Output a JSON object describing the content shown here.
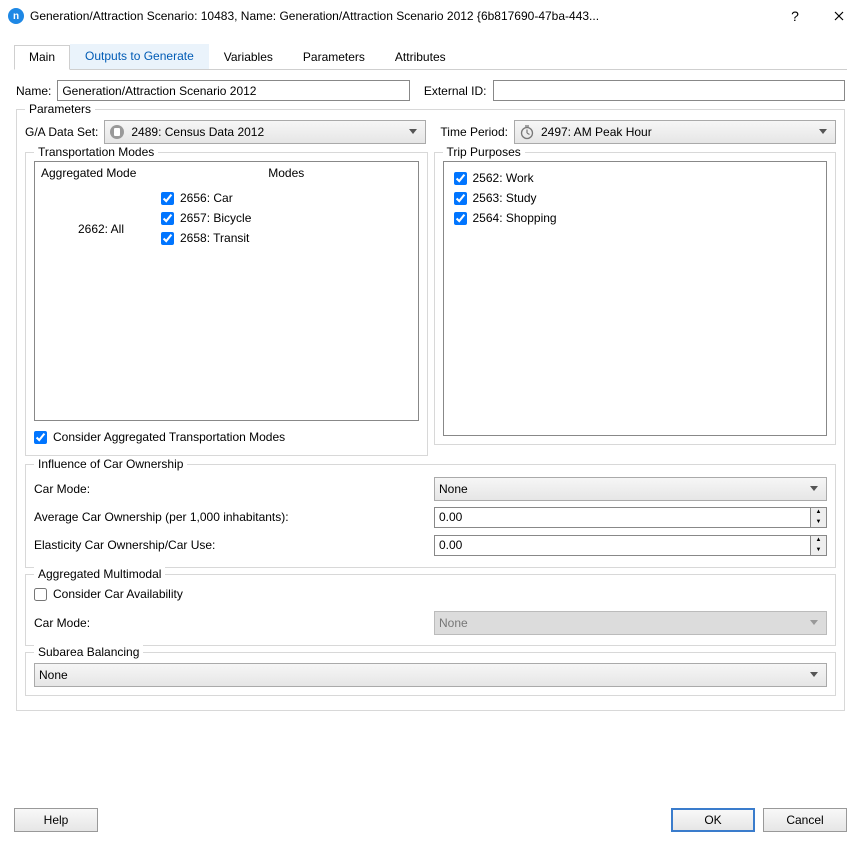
{
  "window": {
    "title": "Generation/Attraction Scenario: 10483, Name: Generation/Attraction Scenario 2012  {6b817690-47ba-443..."
  },
  "tabs": [
    "Main",
    "Outputs to Generate",
    "Variables",
    "Parameters",
    "Attributes"
  ],
  "active_tab": "Main",
  "form": {
    "name_label": "Name:",
    "name_value": "Generation/Attraction Scenario 2012",
    "external_id_label": "External ID:",
    "external_id_value": ""
  },
  "parameters": {
    "legend": "Parameters",
    "ga_dataset_label": "G/A Data Set:",
    "ga_dataset_value": "2489: Census Data 2012",
    "time_period_label": "Time Period:",
    "time_period_value": "2497: AM Peak Hour",
    "transportation_modes": {
      "legend": "Transportation Modes",
      "header_agg": "Aggregated Mode",
      "header_modes": "Modes",
      "aggregated": "2662: All",
      "modes": [
        {
          "label": "2656: Car",
          "checked": true
        },
        {
          "label": "2657: Bicycle",
          "checked": true
        },
        {
          "label": "2658: Transit",
          "checked": true
        }
      ],
      "consider_label": "Consider Aggregated Transportation Modes",
      "consider_checked": true
    },
    "trip_purposes": {
      "legend": "Trip Purposes",
      "items": [
        {
          "label": "2562: Work",
          "checked": true
        },
        {
          "label": "2563: Study",
          "checked": true
        },
        {
          "label": "2564: Shopping",
          "checked": true
        }
      ]
    },
    "influence": {
      "legend": "Influence of Car Ownership",
      "car_mode_label": "Car Mode:",
      "car_mode_value": "None",
      "avg_ownership_label": "Average Car Ownership (per 1,000 inhabitants):",
      "avg_ownership_value": "0.00",
      "elasticity_label": "Elasticity Car Ownership/Car Use:",
      "elasticity_value": "0.00"
    },
    "multimodal": {
      "legend": "Aggregated Multimodal",
      "consider_label": "Consider Car Availability",
      "consider_checked": false,
      "car_mode_label": "Car Mode:",
      "car_mode_value": "None"
    },
    "subarea": {
      "legend": "Subarea Balancing",
      "value": "None"
    }
  },
  "footer": {
    "help": "Help",
    "ok": "OK",
    "cancel": "Cancel"
  }
}
